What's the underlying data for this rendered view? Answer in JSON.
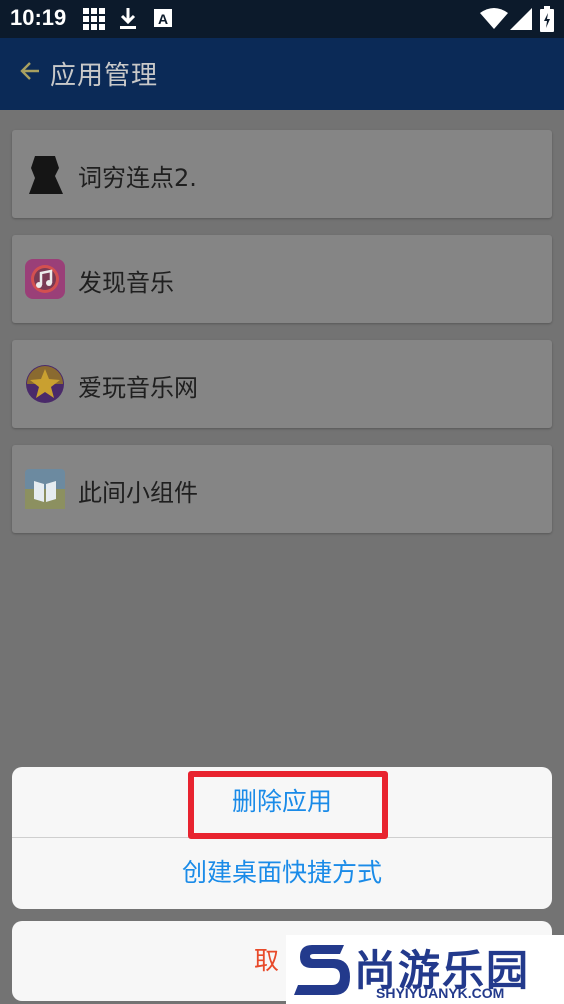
{
  "status_bar": {
    "time": "10:19",
    "icons": [
      "grid-icon",
      "download-icon",
      "a-icon",
      "wifi-icon",
      "signal-icon",
      "battery-icon"
    ]
  },
  "app_bar": {
    "title": "应用管理",
    "back_icon": "back-arrow-icon"
  },
  "apps": [
    {
      "name": "词穷连点2.",
      "icon": "ciqiong-app-icon"
    },
    {
      "name": "发现音乐",
      "icon": "music-app-icon"
    },
    {
      "name": "爱玩音乐网",
      "icon": "aiwan-app-icon"
    },
    {
      "name": "此间小组件",
      "icon": "widget-app-icon"
    }
  ],
  "action_sheet": {
    "options": [
      "删除应用",
      "创建桌面快捷方式"
    ],
    "cancel": "取"
  },
  "watermark": {
    "title": "尚游乐园",
    "subtitle": "SHYIYUANYK.COM"
  },
  "colors": {
    "app_bar": "#0b2a57",
    "accent": "#1a8be8",
    "cancel": "#e84a2a",
    "highlight": "#e8232f",
    "watermark": "#233a8c"
  }
}
